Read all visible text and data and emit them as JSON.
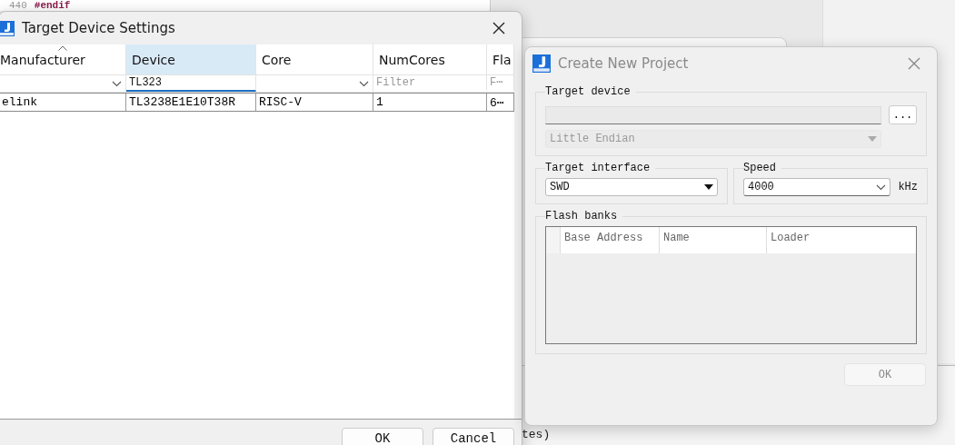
{
  "background": {
    "line_number": "440",
    "code": "#endif",
    "console_text": "tes)"
  },
  "device_dialog": {
    "title": "Target Device Settings",
    "columns": [
      {
        "label": "Manufacturer",
        "sorted": true,
        "selected": false,
        "filter": {
          "kind": "dropdown"
        }
      },
      {
        "label": "Device",
        "sorted": false,
        "selected": true,
        "filter": {
          "kind": "text",
          "value": "TL323",
          "focused": true
        }
      },
      {
        "label": "Core",
        "sorted": false,
        "selected": false,
        "filter": {
          "kind": "dropdown"
        }
      },
      {
        "label": "NumCores",
        "sorted": false,
        "selected": false,
        "filter": {
          "kind": "text",
          "placeholder": "Filter",
          "focused": false
        }
      },
      {
        "label": "Fla",
        "sorted": false,
        "selected": false,
        "filter": {
          "kind": "text",
          "placeholder": "F⋯",
          "focused": false
        }
      }
    ],
    "rows": [
      {
        "cells": [
          "elink",
          "TL3238E1E10T38R",
          "RISC-V",
          "1",
          "6⋯"
        ],
        "selected": false
      }
    ],
    "buttons": [
      "OK",
      "Cancel"
    ]
  },
  "project_dialog": {
    "title": "Create New Project",
    "active": false,
    "target_device": {
      "label": "Target device",
      "browse_button": "...",
      "endian": {
        "value": "Little Endian",
        "disabled": true
      }
    },
    "target_interface": {
      "label": "Target interface",
      "value": "SWD"
    },
    "speed": {
      "label": "Speed",
      "value": "4000",
      "unit": "kHz"
    },
    "flash_banks": {
      "label": "Flash banks",
      "columns": [
        "Base Address",
        "Name",
        "Loader"
      ]
    },
    "ok_button": {
      "label": "OK",
      "disabled": true
    }
  }
}
